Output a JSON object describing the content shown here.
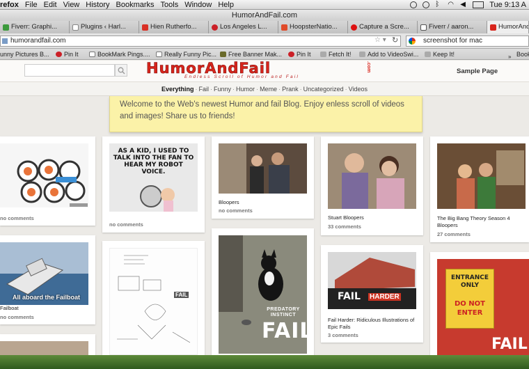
{
  "menubar": {
    "app": "refox",
    "items": [
      "File",
      "Edit",
      "View",
      "History",
      "Bookmarks",
      "Tools",
      "Window",
      "Help"
    ],
    "clock": "Tue 9:13 A"
  },
  "window": {
    "title": "HumorAndFail.com"
  },
  "tabs": [
    {
      "label": "Fiverr: Graphi...",
      "color": "#3c9a3c"
    },
    {
      "label": "Plugins ‹ Harl...",
      "color": "#888888"
    },
    {
      "label": "Hien Rutherfo...",
      "color": "#d93025"
    },
    {
      "label": "Los Angeles L...",
      "color": "#cb2027"
    },
    {
      "label": "HoopsterNatio...",
      "color": "#e04b2a"
    },
    {
      "label": "Capture a Scre...",
      "color": "#d11"
    },
    {
      "label": "Fiverr / aaron...",
      "color": "#555555"
    },
    {
      "label": "HumorAndFail...",
      "color": "#d8251c"
    }
  ],
  "navbar": {
    "url": "humorandfail.com",
    "search_value": "screenshot for mac"
  },
  "bookmarks": [
    "unny Pictures B...",
    "Pin It",
    "BookMark Pings....",
    "Really Funny Pic...",
    "Free Banner Mak...",
    "Pin It",
    "Fetch It!",
    "Add to VideoSwi...",
    "Keep It!",
    "Book"
  ],
  "site": {
    "logo_text": "HumorAndFail",
    "logo_dotcom": ".com",
    "logo_tagline": "Endless Scroll of Humor and Fail",
    "sample_page": "Sample Page",
    "search_placeholder": ""
  },
  "categories": [
    {
      "label": "Everything",
      "current": true
    },
    {
      "label": "Fail"
    },
    {
      "label": "Funny"
    },
    {
      "label": "Humor"
    },
    {
      "label": "Meme"
    },
    {
      "label": "Prank"
    },
    {
      "label": "Uncategorized"
    },
    {
      "label": "Videos"
    }
  ],
  "welcome_text": "Welcome to the Web's newest Humor and fail Blog. Enjoy enless scroll of videos and images! Share us to friends!",
  "cards": {
    "sushi": {
      "meta": "no comments",
      "image_text": ""
    },
    "kid_fan": {
      "meta": "no comments",
      "image_text": "AS A KID, I USED TO TALK INTO THE FAN TO HEAR MY ROBOT VOICE."
    },
    "bloopers": {
      "title": "Bloopers",
      "meta": "no comments"
    },
    "stuart": {
      "title": "Stuart Bloopers",
      "meta": "33 comments"
    },
    "bigbang": {
      "title": "The Big Bang Theory Season 4 Bloopers",
      "meta": "27 comments"
    },
    "failboat": {
      "title": "Failboat",
      "meta": "no comments",
      "image_text": "All aboard the Failboat"
    },
    "drawing": {
      "image_text": "FAIL"
    },
    "cat": {
      "image_text_top": "PREDATORY INSTINCT",
      "image_text_big": "FAIL"
    },
    "failharder": {
      "title": "Fail Harder: Ridiculous Illustrations of Epic Fails",
      "meta": "3 comments",
      "image_text_a": "FAIL",
      "image_text_b": "HARDER"
    },
    "entrance": {
      "sign_text_a": "ENTRANCE ONLY",
      "sign_text_b": "DO NOT ENTER",
      "image_text": "FAIL"
    }
  }
}
